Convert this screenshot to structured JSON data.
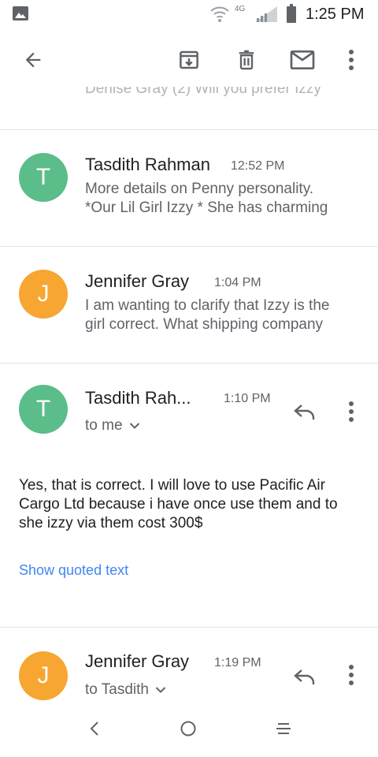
{
  "status_bar": {
    "network": "4G",
    "time": "1:25 PM",
    "icons": [
      "photo-icon",
      "wifi-icon",
      "signal-icon",
      "battery-icon"
    ]
  },
  "app_bar": {
    "icons": [
      "back-arrow-icon",
      "archive-icon",
      "delete-icon",
      "mail-icon",
      "more-vert-icon"
    ]
  },
  "thread": {
    "collapsed_peek": "Denise Gray (2) Will you prefer Izzy",
    "messages": [
      {
        "initial": "T",
        "avatar_color": "#5bbd89",
        "sender": "Tasdith Rahman",
        "time": "12:52 PM",
        "snippet_lines": [
          "More details on Penny personality.",
          "*Our Lil Girl Izzy * She has charming"
        ]
      },
      {
        "initial": "J",
        "avatar_color": "#f6a631",
        "sender": "Jennifer Gray",
        "time": "1:04 PM",
        "snippet_lines": [
          "I am wanting to clarify that Izzy is the",
          "girl correct. What shipping company"
        ]
      }
    ],
    "expanded_message": {
      "initial": "T",
      "avatar_color": "#5bbd89",
      "sender": "Tasdith Rah...",
      "time": "1:10 PM",
      "recipient": "to me",
      "body_lines": [
        "Yes, that is correct. I will love to use Pacific Air",
        "Cargo Ltd because i have once use them and to",
        "she izzy via them cost 300$"
      ],
      "show_quoted": "Show quoted text"
    },
    "last_message": {
      "initial": "J",
      "avatar_color": "#f6a631",
      "sender": "Jennifer Gray",
      "time": "1:19 PM",
      "recipient": "to Tasdith"
    }
  },
  "nav_bar": {
    "icons": [
      "back-nav-icon",
      "home-nav-icon",
      "recents-nav-icon"
    ]
  },
  "colors": {
    "link": "#4285f4",
    "icon_gray": "#5f6368",
    "divider": "#e3e3e3"
  }
}
